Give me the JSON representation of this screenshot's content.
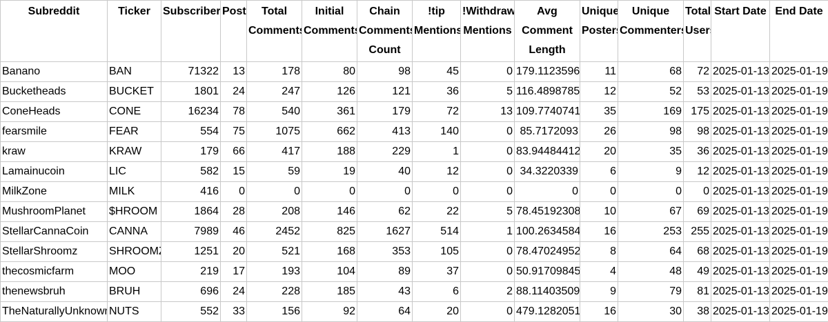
{
  "headers": [
    "Subreddit",
    "Ticker",
    "Subscribers",
    "Posts",
    "Total Comments",
    "Initial Comments",
    "Chain Comments Count",
    "!tip Mentions",
    "!Withdraw Mentions",
    "Avg Comment Length",
    "Unique Posters",
    "Unique Commenters",
    "Total Users",
    "Start Date",
    "End Date"
  ],
  "rows": [
    [
      "Banano",
      "BAN",
      "71322",
      "13",
      "178",
      "80",
      "98",
      "45",
      "0",
      "179.1123596",
      "11",
      "68",
      "72",
      "2025-01-13",
      "2025-01-19"
    ],
    [
      "Bucketheads",
      "BUCKET",
      "1801",
      "24",
      "247",
      "126",
      "121",
      "36",
      "5",
      "116.4898785",
      "12",
      "52",
      "53",
      "2025-01-13",
      "2025-01-19"
    ],
    [
      "ConeHeads",
      "CONE",
      "16234",
      "78",
      "540",
      "361",
      "179",
      "72",
      "13",
      "109.7740741",
      "35",
      "169",
      "175",
      "2025-01-13",
      "2025-01-19"
    ],
    [
      "fearsmile",
      "FEAR",
      "554",
      "75",
      "1075",
      "662",
      "413",
      "140",
      "0",
      "85.7172093",
      "26",
      "98",
      "98",
      "2025-01-13",
      "2025-01-19"
    ],
    [
      "kraw",
      "KRAW",
      "179",
      "66",
      "417",
      "188",
      "229",
      "1",
      "0",
      "83.94484412",
      "20",
      "35",
      "36",
      "2025-01-13",
      "2025-01-19"
    ],
    [
      "Lamainucoin",
      "LIC",
      "582",
      "15",
      "59",
      "19",
      "40",
      "12",
      "0",
      "34.3220339",
      "6",
      "9",
      "12",
      "2025-01-13",
      "2025-01-19"
    ],
    [
      "MilkZone",
      "MILK",
      "416",
      "0",
      "0",
      "0",
      "0",
      "0",
      "0",
      "0",
      "0",
      "0",
      "0",
      "2025-01-13",
      "2025-01-19"
    ],
    [
      "MushroomPlanet",
      "$HROOM",
      "1864",
      "28",
      "208",
      "146",
      "62",
      "22",
      "5",
      "78.45192308",
      "10",
      "67",
      "69",
      "2025-01-13",
      "2025-01-19"
    ],
    [
      "StellarCannaCoin",
      "CANNA",
      "7989",
      "46",
      "2452",
      "825",
      "1627",
      "514",
      "1",
      "100.2634584",
      "16",
      "253",
      "255",
      "2025-01-13",
      "2025-01-19"
    ],
    [
      "StellarShroomz",
      "SHROOMZ",
      "1251",
      "20",
      "521",
      "168",
      "353",
      "105",
      "0",
      "78.47024952",
      "8",
      "64",
      "68",
      "2025-01-13",
      "2025-01-19"
    ],
    [
      "thecosmicfarm",
      "MOO",
      "219",
      "17",
      "193",
      "104",
      "89",
      "37",
      "0",
      "50.91709845",
      "4",
      "48",
      "49",
      "2025-01-13",
      "2025-01-19"
    ],
    [
      "thenewsbruh",
      "BRUH",
      "696",
      "24",
      "228",
      "185",
      "43",
      "6",
      "2",
      "88.11403509",
      "9",
      "79",
      "81",
      "2025-01-13",
      "2025-01-19"
    ],
    [
      "TheNaturallyUnknown",
      "NUTS",
      "552",
      "33",
      "156",
      "92",
      "64",
      "20",
      "0",
      "479.1282051",
      "16",
      "30",
      "38",
      "2025-01-13",
      "2025-01-19"
    ]
  ]
}
